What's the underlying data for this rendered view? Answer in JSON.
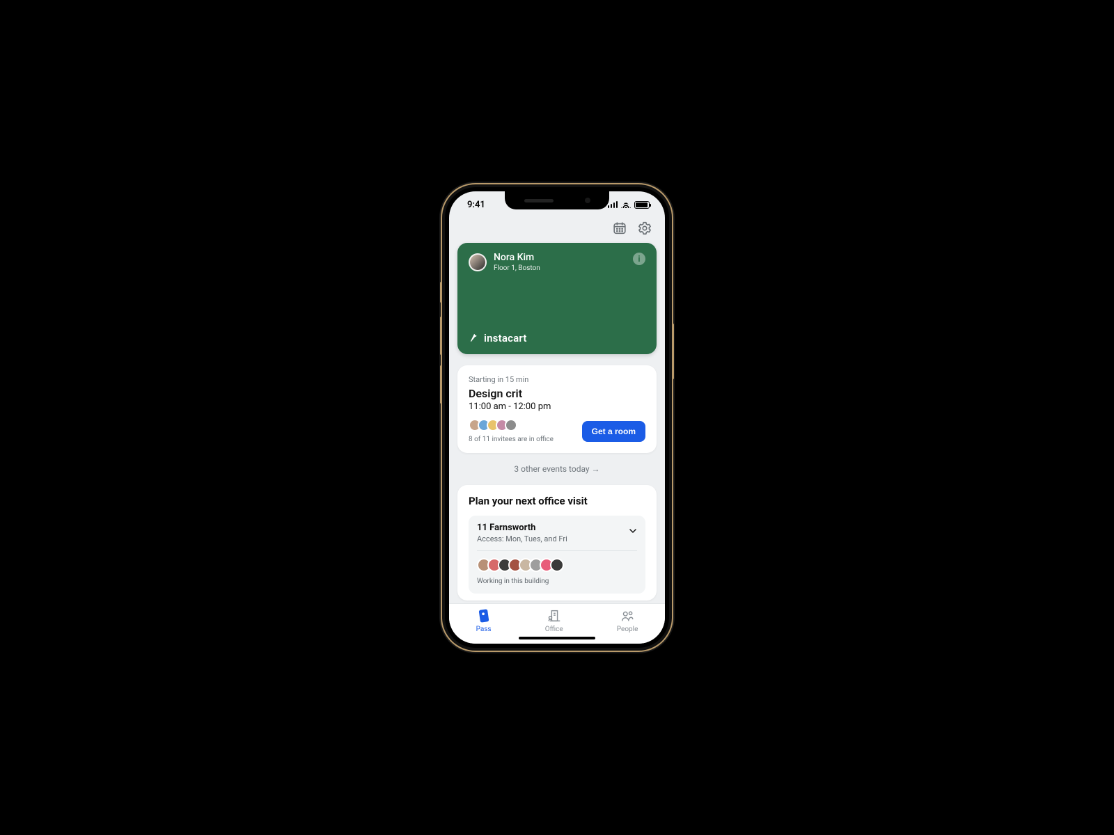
{
  "status": {
    "time": "9:41"
  },
  "pass": {
    "user_name": "Nora Kim",
    "location": "Floor 1, Boston",
    "brand": "instacart",
    "card_color": "#2C6E49"
  },
  "event": {
    "starting_label": "Starting in 15 min",
    "title": "Design crit",
    "time_range": "11:00 am - 12:00 pm",
    "invitees_text": "8 of 11 invitees are in office",
    "cta_label": "Get a room"
  },
  "more_events_label": "3 other events today →",
  "plan": {
    "heading": "Plan your next office visit",
    "building_name": "11 Farnsworth",
    "access_text": "Access: Mon, Tues, and Fri",
    "working_text": "Working in this building"
  },
  "tabs": {
    "pass": "Pass",
    "office": "Office",
    "people": "People"
  },
  "colors": {
    "accent": "#1B5CE6"
  }
}
